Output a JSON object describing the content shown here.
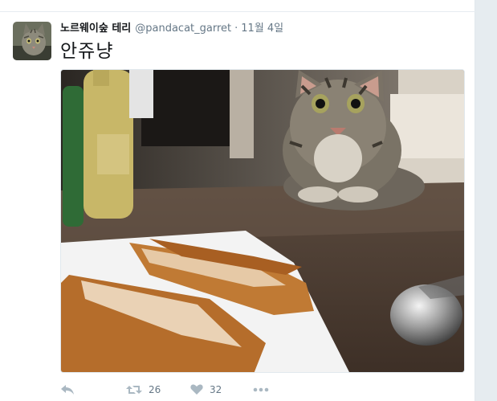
{
  "tweet": {
    "author_name": "노르웨이숲 테리",
    "author_handle": "@pandacat_garret",
    "separator": "·",
    "timestamp": "11월 4일",
    "text": "안쥬냥"
  },
  "actions": {
    "retweet_count": "26",
    "like_count": "32"
  },
  "colors": {
    "secondary_text": "#657786",
    "icon": "#aab8c2",
    "border": "#e1e8ed"
  },
  "icons": {
    "reply": "reply-icon",
    "retweet": "retweet-icon",
    "like": "heart-icon",
    "more": "more-icon"
  }
}
